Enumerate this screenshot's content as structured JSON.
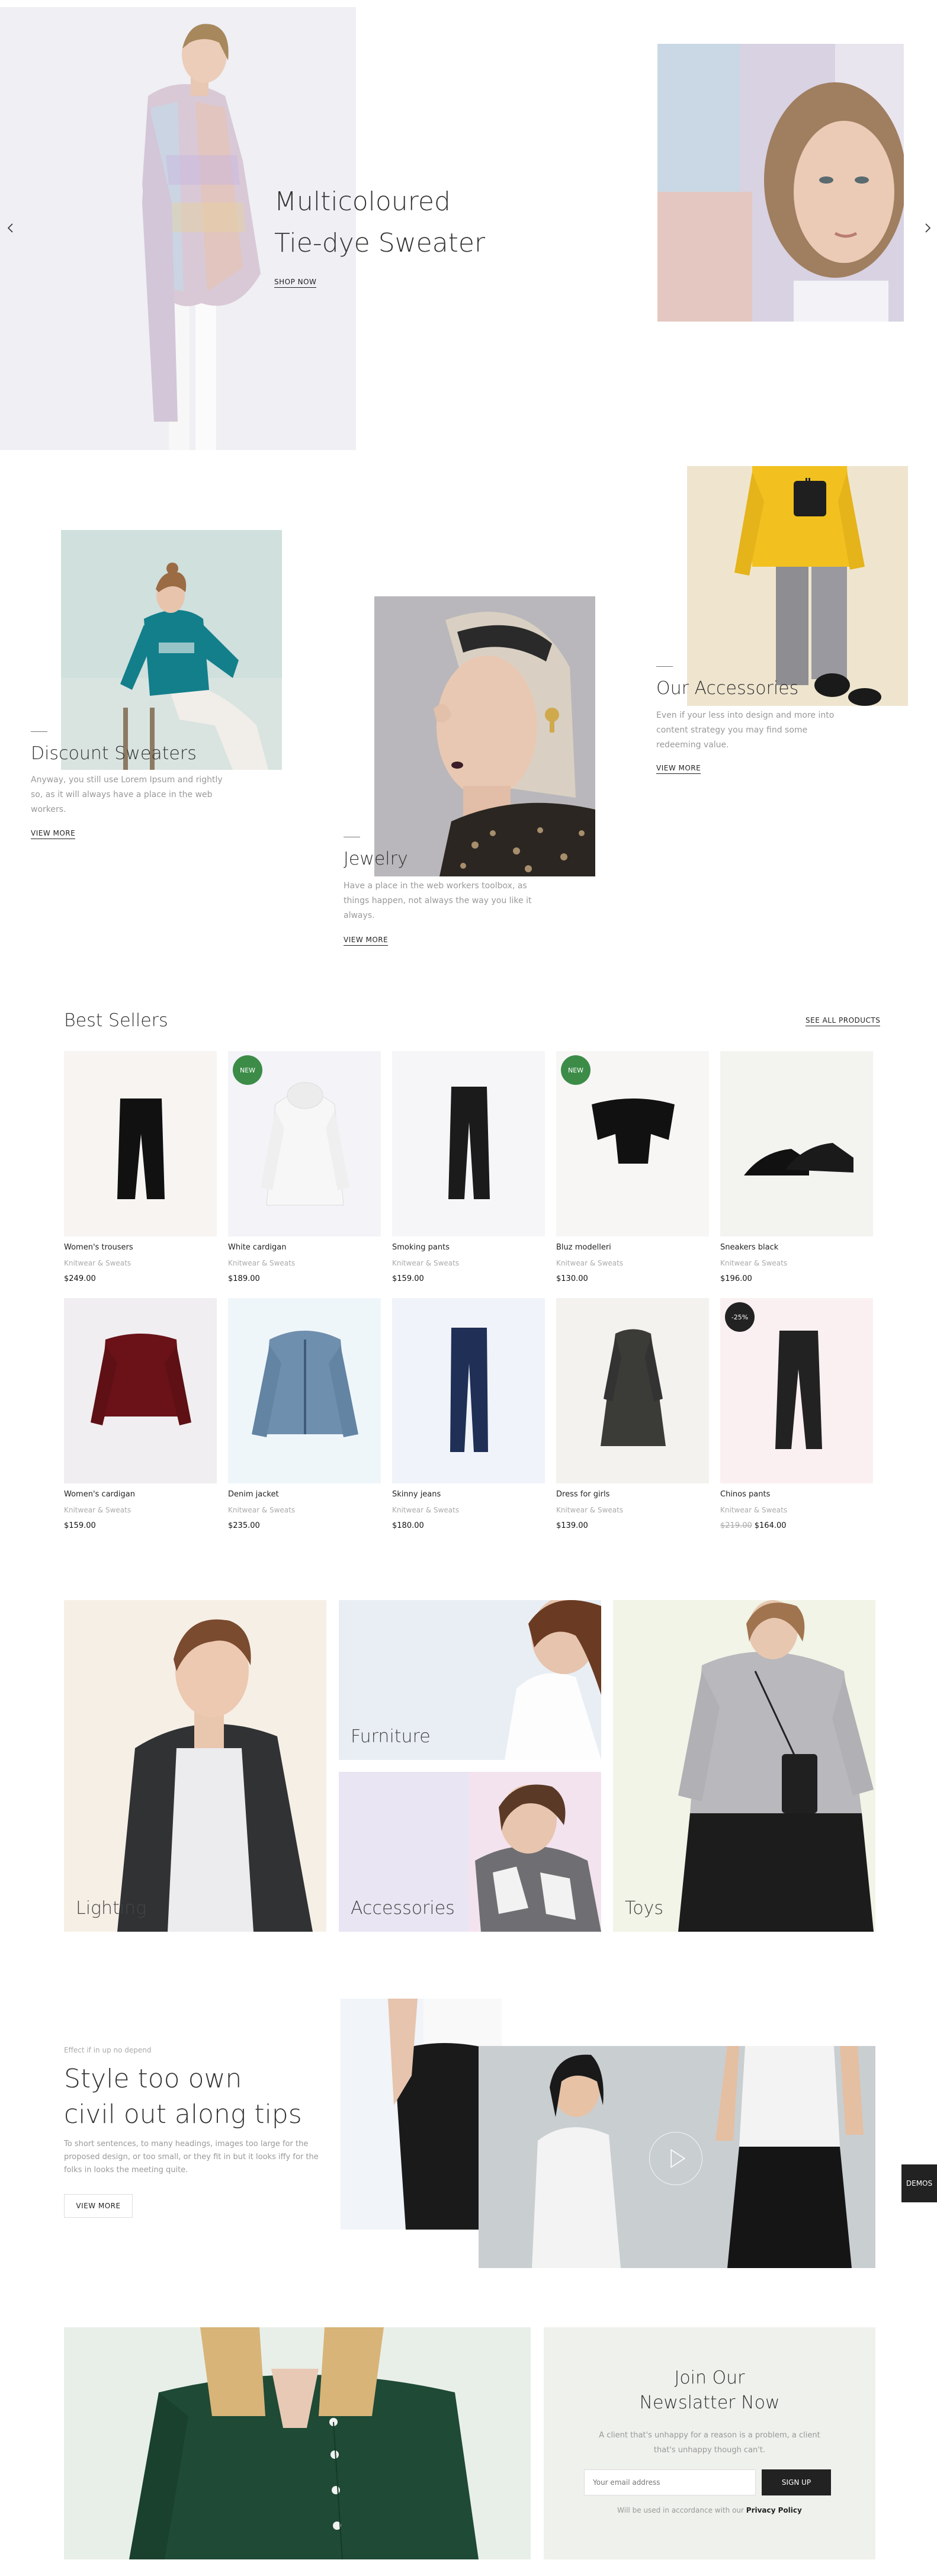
{
  "hero": {
    "title_line1": "Multicoloured",
    "title_line2": "Tie-dye Sweater",
    "cta": "SHOP NOW"
  },
  "features": [
    {
      "title": "Discount Sweaters",
      "text": "Anyway, you still use Lorem Ipsum and rightly so, as it will always have a place in the web workers.",
      "link": "VIEW MORE"
    },
    {
      "title": "Jewelry",
      "text": "Have a place in the web workers toolbox, as things happen, not always the way you like it always.",
      "link": "VIEW MORE"
    },
    {
      "title": "Our Accessories",
      "text": "Even if your less into design and more into content strategy you may find some redeeming value.",
      "link": "VIEW MORE"
    }
  ],
  "best_sellers": {
    "title": "Best Sellers",
    "see_all": "SEE ALL PRODUCTS",
    "products": [
      {
        "name": "Women's trousers",
        "category": "Knitwear & Sweats",
        "price": "$249.00",
        "badge": ""
      },
      {
        "name": "White cardigan",
        "category": "Knitwear & Sweats",
        "price": "$189.00",
        "badge": "NEW"
      },
      {
        "name": "Smoking pants",
        "category": "Knitwear & Sweats",
        "price": "$159.00",
        "badge": ""
      },
      {
        "name": "Bluz modelleri",
        "category": "Knitwear & Sweats",
        "price": "$130.00",
        "badge": "NEW"
      },
      {
        "name": "Sneakers black",
        "category": "Knitwear & Sweats",
        "price": "$196.00",
        "badge": ""
      },
      {
        "name": "Women's cardigan",
        "category": "Knitwear & Sweats",
        "price": "$159.00",
        "badge": ""
      },
      {
        "name": "Denim jacket",
        "category": "Knitwear & Sweats",
        "price": "$235.00",
        "badge": ""
      },
      {
        "name": "Skinny jeans",
        "category": "Knitwear & Sweats",
        "price": "$180.00",
        "badge": ""
      },
      {
        "name": "Dress for girls",
        "category": "Knitwear & Sweats",
        "price": "$139.00",
        "badge": ""
      },
      {
        "name": "Chinos pants",
        "category": "Knitwear & Sweats",
        "price": "$164.00",
        "old_price": "$219.00",
        "badge": "-25%"
      }
    ]
  },
  "categories": [
    "Lighting",
    "Furniture",
    "Accessories",
    "Toys"
  ],
  "promo": {
    "kicker": "Effect if in up no depend",
    "title_line1": "Style too own",
    "title_line2": "civil out along tips",
    "text": "To short sentences, to many headings, images too large for the proposed design, or too small, or they fit in but it looks iffy for the folks in looks the meeting quite.",
    "button": "VIEW MORE"
  },
  "demos_tab": "DEMOS",
  "newsletter": {
    "title_line1": "Join Our",
    "title_line2": "Newslatter Now",
    "text": "A client that's unhappy for a reason is a problem, a client that's unhappy though can't.",
    "placeholder": "Your email address",
    "button": "SIGN UP",
    "note": "Will be used in accordance with our",
    "policy": "Privacy Policy"
  },
  "icons": {
    "prev": "chevron-left-icon",
    "next": "chevron-right-icon",
    "play": "play-icon"
  },
  "colors": {
    "badge_new": "#3c8c48",
    "badge_sale": "#222222",
    "newsletter_bg": "#eef1ec"
  }
}
